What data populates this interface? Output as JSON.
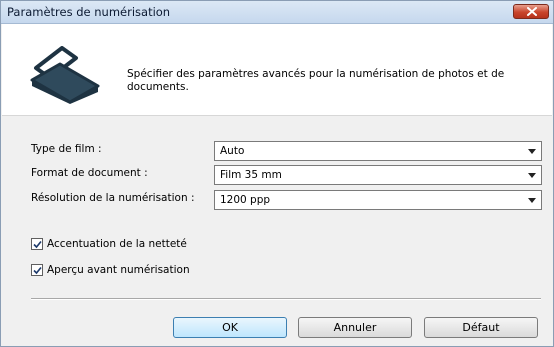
{
  "window": {
    "title": "Paramètres de numérisation"
  },
  "header": {
    "description": "Spécifier des paramètres avancés pour la numérisation de photos et de documents."
  },
  "fields": {
    "film_type": {
      "label": "Type de film :",
      "value": "Auto"
    },
    "document_format": {
      "label": "Format de document :",
      "value": "Film 35 mm"
    },
    "scan_resolution": {
      "label": "Résolution de la numérisation :",
      "value": "1200 ppp"
    }
  },
  "options": {
    "sharpen": {
      "label": "Accentuation de la netteté",
      "checked": true
    },
    "preview_before_scan": {
      "label": "Aperçu avant numérisation",
      "checked": true
    }
  },
  "buttons": {
    "ok": "OK",
    "cancel": "Annuler",
    "default": "Défaut"
  },
  "colors": {
    "titlebar": "#c6d8ee",
    "close_button": "#c9452c",
    "dialog_background": "#f0f0f0",
    "default_button_border": "#3c7fb1"
  },
  "icons": {
    "close": "close-icon",
    "scanner": "scanner-icon",
    "checkmark": "checkmark-icon",
    "dropdown": "chevron-down-icon"
  }
}
